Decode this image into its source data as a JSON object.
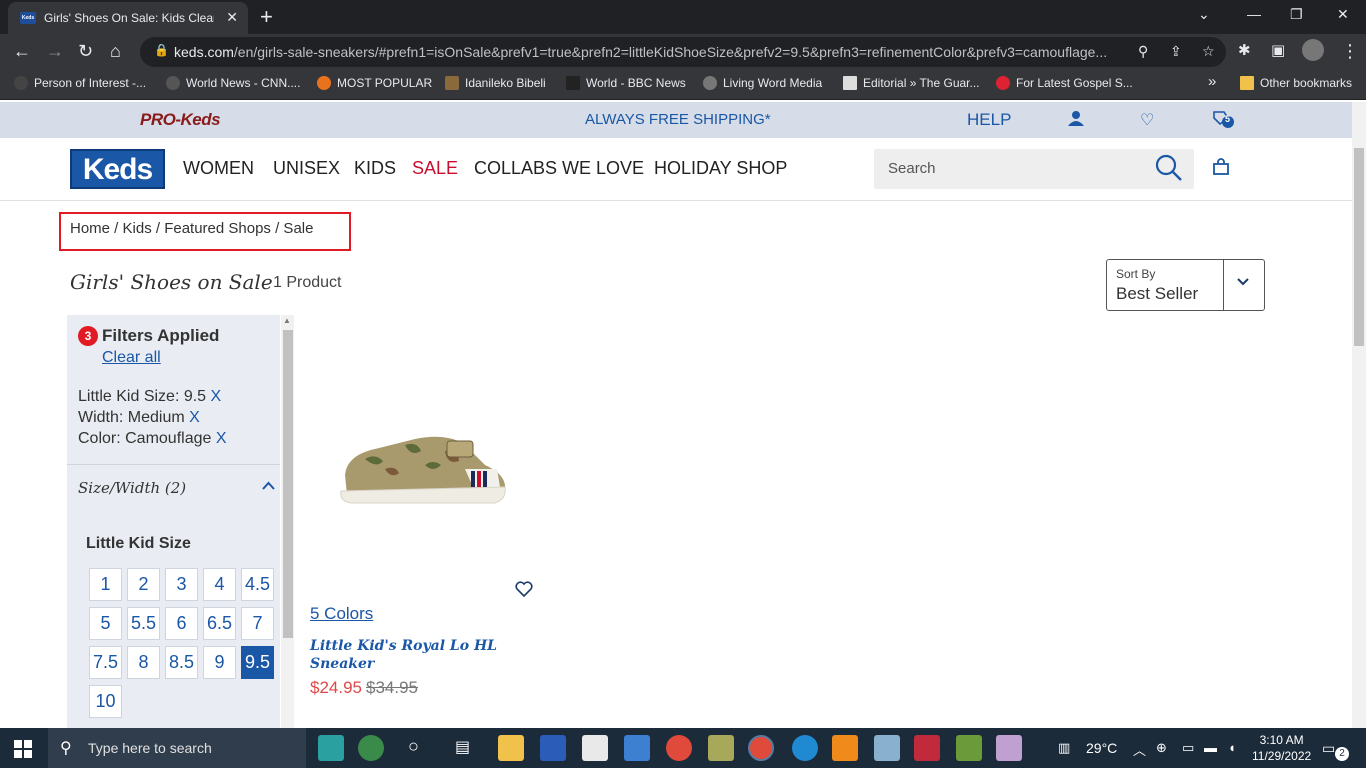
{
  "browser": {
    "tab_title": "Girls' Shoes On Sale: Kids Clearan",
    "favicon_text": "Keds",
    "url_host": "keds.com",
    "url_rest": "/en/girls-sale-sneakers/#prefn1=isOnSale&prefv1=true&prefn2=littleKidShoeSize&prefv2=9.5&prefn3=refinementColor&prefv3=camouflage...",
    "bookmarks": [
      {
        "label": "Person of Interest -...",
        "color": "#444"
      },
      {
        "label": "World News - CNN....",
        "color": "#555"
      },
      {
        "label": "MOST POPULAR",
        "color": "#e8731c"
      },
      {
        "label": "Idanileko Bibeli",
        "color": "#8a6a3a"
      },
      {
        "label": "World - BBC News",
        "color": "#222"
      },
      {
        "label": "Living Word Media",
        "color": "#777"
      },
      {
        "label": "Editorial » The Guar...",
        "color": "#ddd"
      },
      {
        "label": "For Latest Gospel S...",
        "color": "#d23"
      }
    ],
    "overflow_label": "»",
    "other_bookmarks": "Other bookmarks"
  },
  "site": {
    "pro_keds": "PRO-Keds",
    "shipping": "ALWAYS FREE SHIPPING*",
    "help": "HELP",
    "cart_count": "5",
    "logo": "Keds",
    "nav": [
      "WOMEN",
      "UNISEX",
      "KIDS",
      "SALE",
      "COLLABS WE LOVE",
      "HOLIDAY SHOP"
    ],
    "search_placeholder": "Search",
    "accent": "#1a57a6",
    "sale_color": "#c8102e"
  },
  "breadcrumb": "Home  /  Kids  /  Featured Shops  /  Sale",
  "page": {
    "title": "Girls' Shoes on Sale",
    "count": "1 Product",
    "sort_label": "Sort By",
    "sort_value": "Best Seller"
  },
  "filters": {
    "count": "3",
    "heading": "Filters Applied",
    "clear_all": "Clear all",
    "applied": [
      {
        "label": "Little Kid Size: 9.5",
        "x": "X"
      },
      {
        "label": "Width: Medium",
        "x": "X"
      },
      {
        "label": "Color: Camouflage",
        "x": "X"
      }
    ],
    "section": "Size/Width (2)",
    "subheading": "Little Kid Size",
    "sizes": [
      "1",
      "2",
      "3",
      "4",
      "4.5",
      "5",
      "5.5",
      "6",
      "6.5",
      "7",
      "7.5",
      "8",
      "8.5",
      "9",
      "9.5",
      "10"
    ],
    "selected_size": "9.5"
  },
  "product": {
    "colors": "5 Colors",
    "name": "Little Kid's Royal Lo HL Sneaker",
    "price_now": "$24.95",
    "price_was": "$34.95"
  },
  "taskbar": {
    "search_placeholder": "Type here to search",
    "weather": "29°C",
    "time": "3:10 AM",
    "date": "11/29/2022",
    "notifications": "2"
  }
}
